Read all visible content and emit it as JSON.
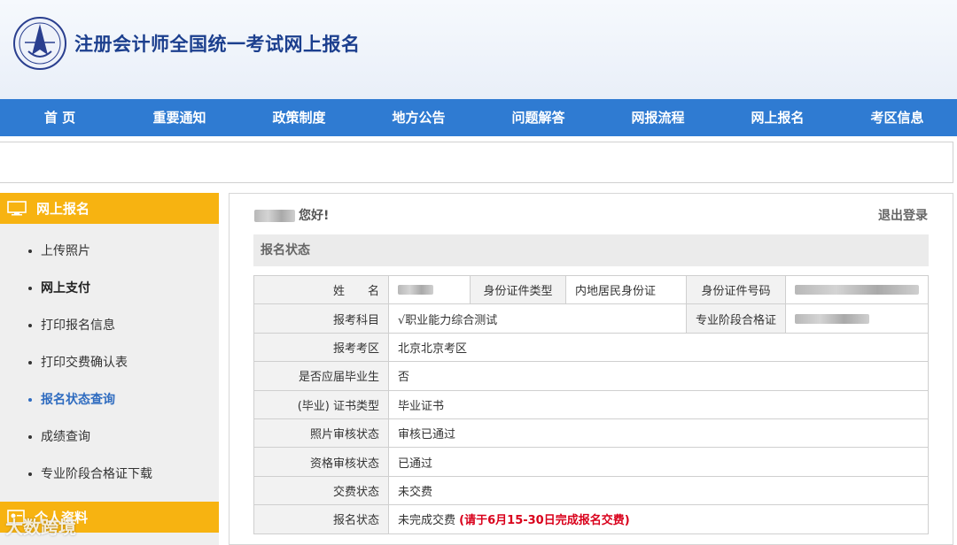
{
  "site": {
    "title": "注册会计师全国统一考试网上报名"
  },
  "nav": [
    "首  页",
    "重要通知",
    "政策制度",
    "地方公告",
    "问题解答",
    "网报流程",
    "网上报名",
    "考区信息"
  ],
  "sidebar": {
    "section_title": "网上报名",
    "items": [
      "上传照片",
      "网上支付",
      "打印报名信息",
      "打印交费确认表",
      "报名状态查询",
      "成绩查询",
      "专业阶段合格证下载"
    ],
    "section2_title": "个人资料"
  },
  "main": {
    "greeting": "您好!",
    "logout": "退出登录",
    "status_header": "报名状态"
  },
  "table": {
    "name_label": "姓　　名",
    "id_type_label": "身份证件类型",
    "id_type_value": "内地居民身份证",
    "id_no_label": "身份证件号码",
    "subject_label": "报考科目",
    "subject_value": "√职业能力综合测试",
    "cert_label": "专业阶段合格证",
    "area_label": "报考考区",
    "area_value": "北京北京考区",
    "graduate_label": "是否应届毕业生",
    "graduate_value": "否",
    "certtype_label": "(毕业) 证书类型",
    "certtype_value": "毕业证书",
    "photo_label": "照片审核状态",
    "photo_value": "审核已通过",
    "qual_label": "资格审核状态",
    "qual_value": "已通过",
    "fee_label": "交费状态",
    "fee_value": "未交费",
    "reg_label": "报名状态",
    "reg_value": "未完成交费",
    "reg_note": "(请于6月15-30日完成报名交费)"
  },
  "watermark": "大数跨境",
  "colors": {
    "nav": "#2f7bd2",
    "sidebar_head": "#f7b311",
    "active": "#2f6cc0",
    "alert": "#d9001b"
  }
}
